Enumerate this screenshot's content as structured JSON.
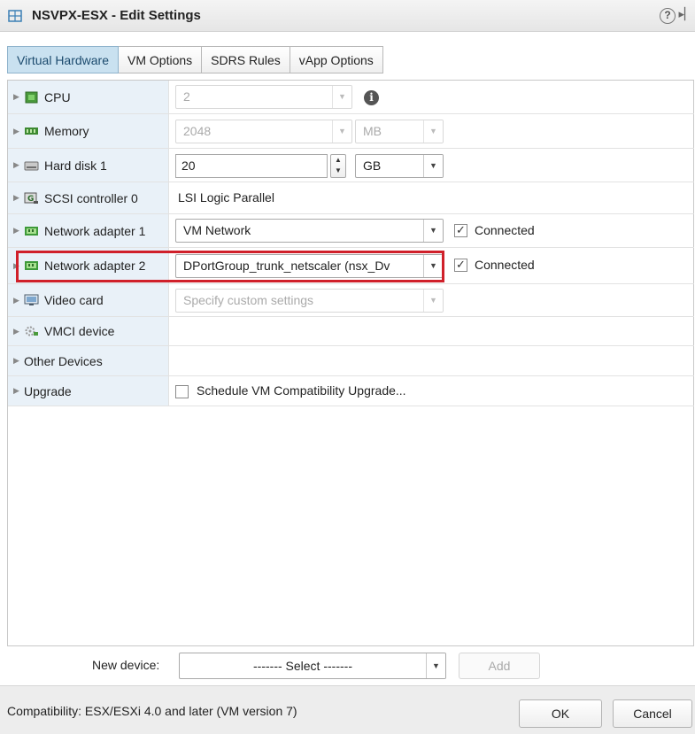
{
  "window": {
    "title": "NSVPX-ESX - Edit Settings",
    "help_glyph": "?",
    "overflow_glyph": "▸▏"
  },
  "tabs": [
    {
      "label": "Virtual Hardware",
      "active": true
    },
    {
      "label": "VM Options",
      "active": false
    },
    {
      "label": "SDRS Rules",
      "active": false
    },
    {
      "label": "vApp Options",
      "active": false
    }
  ],
  "hardware": {
    "cpu": {
      "label": "CPU",
      "icon": "cpu-icon",
      "value": "2",
      "info_glyph": "i"
    },
    "memory": {
      "label": "Memory",
      "icon": "memory-icon",
      "value": "2048",
      "unit": "MB"
    },
    "hard_disk": {
      "label": "Hard disk 1",
      "icon": "hard-disk-icon",
      "value": "20",
      "unit": "GB"
    },
    "scsi": {
      "label": "SCSI controller 0",
      "icon": "scsi-controller-icon",
      "value": "LSI Logic Parallel"
    },
    "net1": {
      "label": "Network adapter 1",
      "icon": "network-adapter-icon",
      "value": "VM Network",
      "connected_label": "Connected",
      "connected": true
    },
    "net2": {
      "label": "Network adapter 2",
      "icon": "network-adapter-icon",
      "value": "DPortGroup_trunk_netscaler (nsx_Dv",
      "connected_label": "Connected",
      "connected": true
    },
    "video": {
      "label": "Video card",
      "icon": "video-card-icon",
      "value": "Specify custom settings"
    },
    "vmci": {
      "label": "VMCI device",
      "icon": "vmci-device-icon"
    },
    "other": {
      "label": "Other Devices"
    },
    "upgrade": {
      "label": "Upgrade",
      "checkbox_label": "Schedule VM Compatibility Upgrade...",
      "checked": false
    }
  },
  "new_device": {
    "label": "New device:",
    "select_value": "------- Select -------",
    "add_label": "Add"
  },
  "footer": {
    "compatibility": "Compatibility: ESX/ESXi 4.0 and later (VM version 7)",
    "ok_label": "OK",
    "cancel_label": "Cancel"
  },
  "colors": {
    "accent_tab": "#c9e1f0",
    "highlight_border": "#d0202a",
    "label_column": "#e9f1f8"
  }
}
